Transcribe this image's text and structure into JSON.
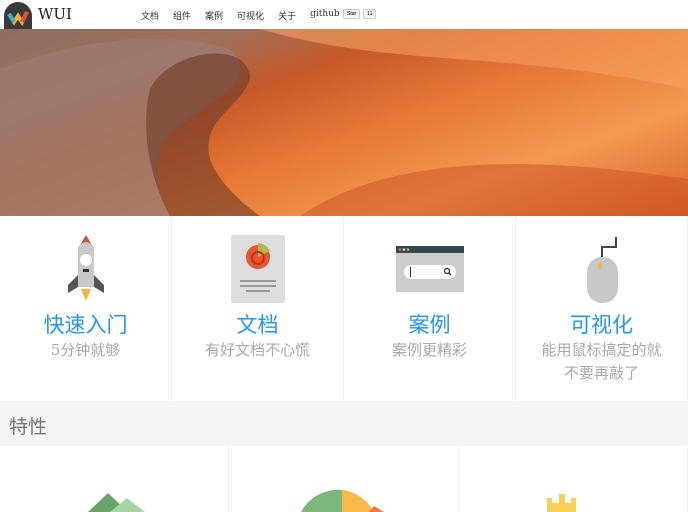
{
  "header": {
    "brand": "WUI",
    "nav": [
      "文档",
      "组件",
      "案例",
      "可视化",
      "关于",
      "github"
    ],
    "star_label": "Star",
    "star_count": "11"
  },
  "cards": [
    {
      "title": "快速入门",
      "sub": "5分钟就够",
      "icon": "rocket-icon"
    },
    {
      "title": "文档",
      "sub": "有好文档不心慌",
      "icon": "document-icon"
    },
    {
      "title": "案例",
      "sub": "案例更精彩",
      "icon": "browser-search-icon"
    },
    {
      "title": "可视化",
      "sub": "能用鼠标搞定的就不要再敲了",
      "icon": "mouse-icon"
    }
  ],
  "features": {
    "title": "特性"
  },
  "colors": {
    "accent": "#2196f3"
  }
}
